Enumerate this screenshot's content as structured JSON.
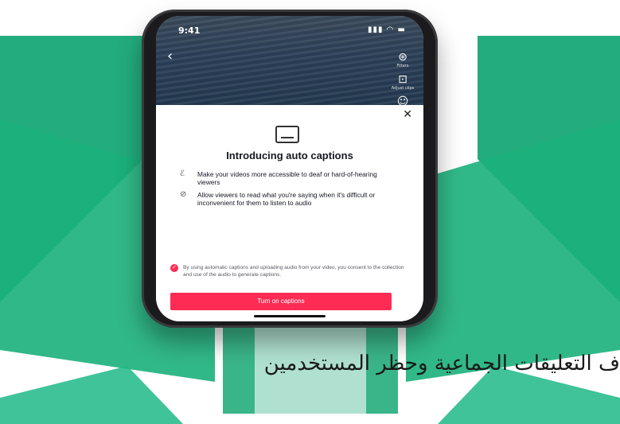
{
  "colors": {
    "watermark_green": "#17a876",
    "accent_red": "#fe2c55",
    "text_dark": "#161823"
  },
  "phone": {
    "status": {
      "time": "9:41",
      "signal_icons": "signal-wifi-battery"
    },
    "video_tools": [
      {
        "icon": "filters-icon",
        "label": "Filters"
      },
      {
        "icon": "captions-icon",
        "label": "Adjust clips"
      },
      {
        "icon": "voice-icon",
        "label": ""
      }
    ],
    "sheet": {
      "close_glyph": "✕",
      "title": "Introducing auto captions",
      "benefits": [
        {
          "icon": "ear-icon",
          "text": "Make your videos more accessible to deaf or hard-of-hearing viewers"
        },
        {
          "icon": "muted-icon",
          "text": "Allow viewers to read what you're saying when it's difficult or inconvenient for them to listen to audio"
        }
      ],
      "consent_text": "By using automatic captions and uploading audio from your video, you consent to the collection and use of the audio to generate captions.",
      "consent_checked": true,
      "button_label": "Turn on captions"
    }
  },
  "caption_arabic": "ف التعليقات الجماعية وحظر المستخدمين"
}
